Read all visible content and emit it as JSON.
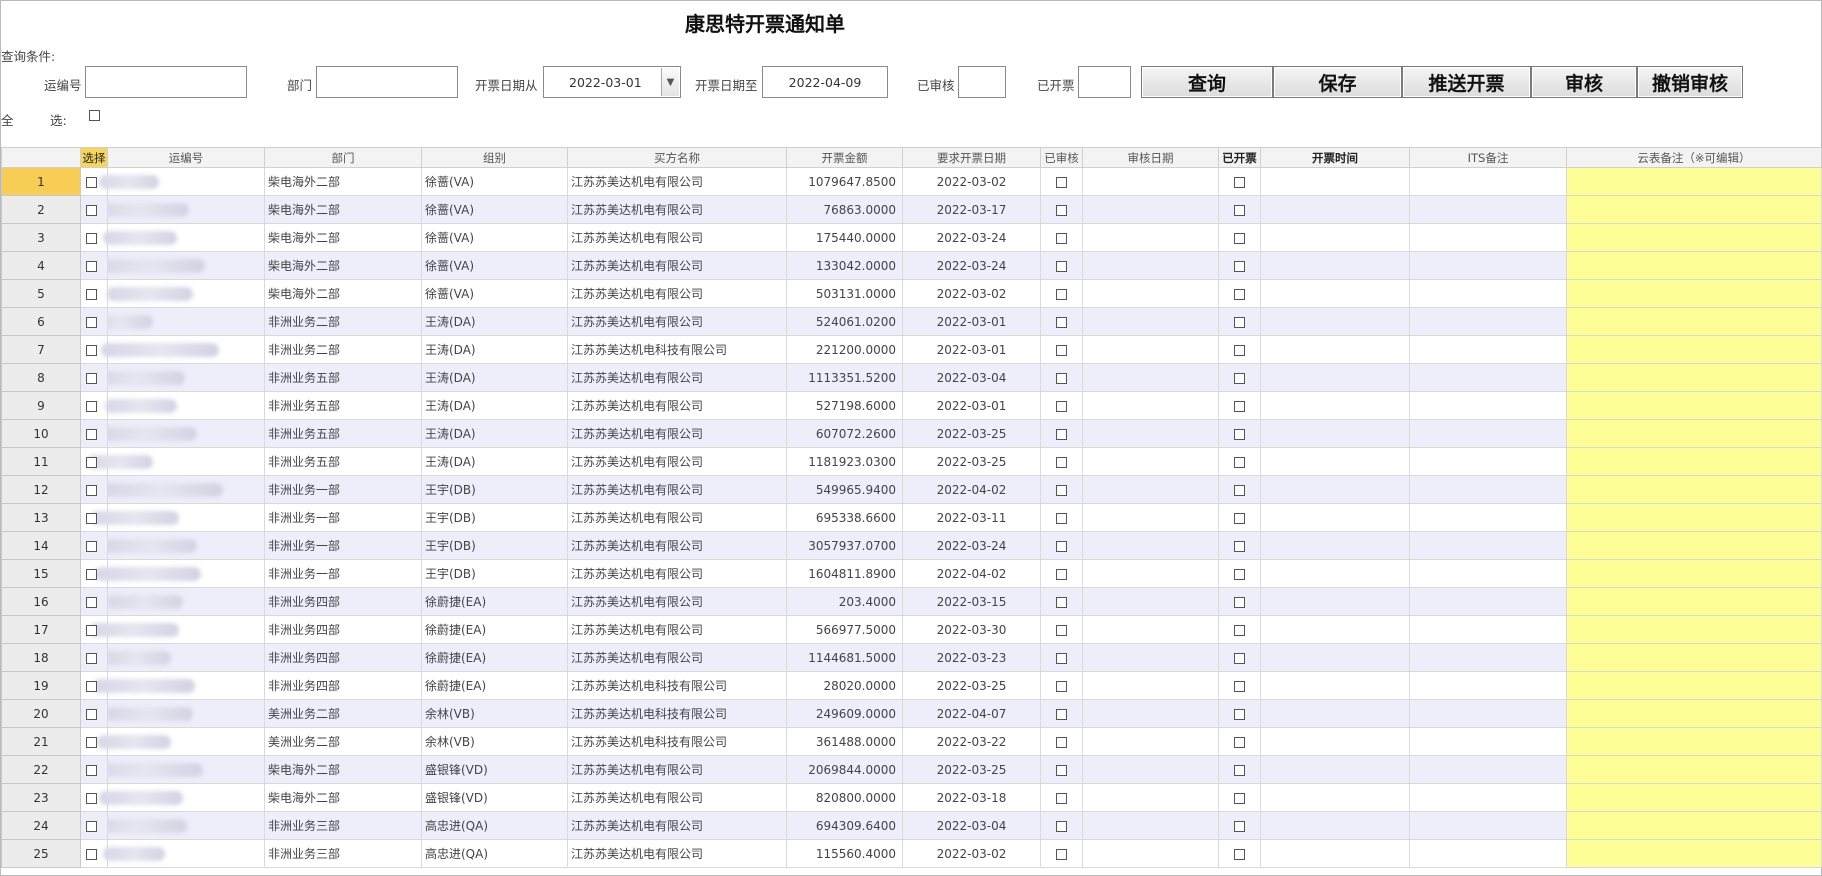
{
  "title": "康思特开票通知单",
  "query": {
    "section_label": "查询条件:",
    "shipment_no_label": "运编号",
    "shipment_no_value": "",
    "dept_label": "部门",
    "dept_value": "",
    "date_from_label": "开票日期从",
    "date_from_value": "2022-03-01",
    "date_to_label": "开票日期至",
    "date_to_value": "2022-04-09",
    "audited_label": "已审核",
    "audited_value": "",
    "invoiced_label": "已开票",
    "invoiced_value": "",
    "select_all_label_1": "全",
    "select_all_label_2": "选:"
  },
  "buttons": {
    "query": "查询",
    "save": "保存",
    "push_invoice": "推送开票",
    "audit": "审核",
    "cancel_audit": "撤销审核"
  },
  "columns": [
    "选择",
    "运编号",
    "部门",
    "组别",
    "买方名称",
    "开票金额",
    "要求开票日期",
    "已审核",
    "审核日期",
    "已开票",
    "开票时间",
    "ITS备注",
    "云表备注（※可编辑）"
  ],
  "rows": [
    {
      "no": "1",
      "dept": "柴电海外二部",
      "group": "徐蔷(VA)",
      "buyer": "江苏苏美达机电有限公司",
      "amount": "1079647.8500",
      "date": "2022-03-02"
    },
    {
      "no": "2",
      "dept": "柴电海外二部",
      "group": "徐蔷(VA)",
      "buyer": "江苏苏美达机电有限公司",
      "amount": "76863.0000",
      "date": "2022-03-17"
    },
    {
      "no": "3",
      "dept": "柴电海外二部",
      "group": "徐蔷(VA)",
      "buyer": "江苏苏美达机电有限公司",
      "amount": "175440.0000",
      "date": "2022-03-24"
    },
    {
      "no": "4",
      "dept": "柴电海外二部",
      "group": "徐蔷(VA)",
      "buyer": "江苏苏美达机电有限公司",
      "amount": "133042.0000",
      "date": "2022-03-24"
    },
    {
      "no": "5",
      "dept": "柴电海外二部",
      "group": "徐蔷(VA)",
      "buyer": "江苏苏美达机电有限公司",
      "amount": "503131.0000",
      "date": "2022-03-02"
    },
    {
      "no": "6",
      "dept": "非洲业务二部",
      "group": "王涛(DA)",
      "buyer": "江苏苏美达机电有限公司",
      "amount": "524061.0200",
      "date": "2022-03-01"
    },
    {
      "no": "7",
      "dept": "非洲业务二部",
      "group": "王涛(DA)",
      "buyer": "江苏苏美达机电科技有限公司",
      "amount": "221200.0000",
      "date": "2022-03-01"
    },
    {
      "no": "8",
      "dept": "非洲业务五部",
      "group": "王涛(DA)",
      "buyer": "江苏苏美达机电有限公司",
      "amount": "1113351.5200",
      "date": "2022-03-04"
    },
    {
      "no": "9",
      "dept": "非洲业务五部",
      "group": "王涛(DA)",
      "buyer": "江苏苏美达机电有限公司",
      "amount": "527198.6000",
      "date": "2022-03-01"
    },
    {
      "no": "10",
      "dept": "非洲业务五部",
      "group": "王涛(DA)",
      "buyer": "江苏苏美达机电有限公司",
      "amount": "607072.2600",
      "date": "2022-03-25"
    },
    {
      "no": "11",
      "dept": "非洲业务五部",
      "group": "王涛(DA)",
      "buyer": "江苏苏美达机电有限公司",
      "amount": "1181923.0300",
      "date": "2022-03-25"
    },
    {
      "no": "12",
      "dept": "非洲业务一部",
      "group": "王宇(DB)",
      "buyer": "江苏苏美达机电有限公司",
      "amount": "549965.9400",
      "date": "2022-04-02"
    },
    {
      "no": "13",
      "dept": "非洲业务一部",
      "group": "王宇(DB)",
      "buyer": "江苏苏美达机电有限公司",
      "amount": "695338.6600",
      "date": "2022-03-11"
    },
    {
      "no": "14",
      "dept": "非洲业务一部",
      "group": "王宇(DB)",
      "buyer": "江苏苏美达机电有限公司",
      "amount": "3057937.0700",
      "date": "2022-03-24"
    },
    {
      "no": "15",
      "dept": "非洲业务一部",
      "group": "王宇(DB)",
      "buyer": "江苏苏美达机电有限公司",
      "amount": "1604811.8900",
      "date": "2022-04-02"
    },
    {
      "no": "16",
      "dept": "非洲业务四部",
      "group": "徐蔚捷(EA)",
      "buyer": "江苏苏美达机电有限公司",
      "amount": "203.4000",
      "date": "2022-03-15"
    },
    {
      "no": "17",
      "dept": "非洲业务四部",
      "group": "徐蔚捷(EA)",
      "buyer": "江苏苏美达机电有限公司",
      "amount": "566977.5000",
      "date": "2022-03-30"
    },
    {
      "no": "18",
      "dept": "非洲业务四部",
      "group": "徐蔚捷(EA)",
      "buyer": "江苏苏美达机电有限公司",
      "amount": "1144681.5000",
      "date": "2022-03-23"
    },
    {
      "no": "19",
      "dept": "非洲业务四部",
      "group": "徐蔚捷(EA)",
      "buyer": "江苏苏美达机电科技有限公司",
      "amount": "28020.0000",
      "date": "2022-03-25"
    },
    {
      "no": "20",
      "dept": "美洲业务二部",
      "group": "余林(VB)",
      "buyer": "江苏苏美达机电科技有限公司",
      "amount": "249609.0000",
      "date": "2022-04-07"
    },
    {
      "no": "21",
      "dept": "美洲业务二部",
      "group": "余林(VB)",
      "buyer": "江苏苏美达机电科技有限公司",
      "amount": "361488.0000",
      "date": "2022-03-22"
    },
    {
      "no": "22",
      "dept": "柴电海外二部",
      "group": "盛银锋(VD)",
      "buyer": "江苏苏美达机电有限公司",
      "amount": "2069844.0000",
      "date": "2022-03-25"
    },
    {
      "no": "23",
      "dept": "柴电海外二部",
      "group": "盛银锋(VD)",
      "buyer": "江苏苏美达机电有限公司",
      "amount": "820800.0000",
      "date": "2022-03-18"
    },
    {
      "no": "24",
      "dept": "非洲业务三部",
      "group": "高忠进(QA)",
      "buyer": "江苏苏美达机电有限公司",
      "amount": "694309.6400",
      "date": "2022-03-04"
    },
    {
      "no": "25",
      "dept": "非洲业务三部",
      "group": "高忠进(QA)",
      "buyer": "江苏苏美达机电有限公司",
      "amount": "115560.4000",
      "date": "2022-03-02"
    }
  ]
}
